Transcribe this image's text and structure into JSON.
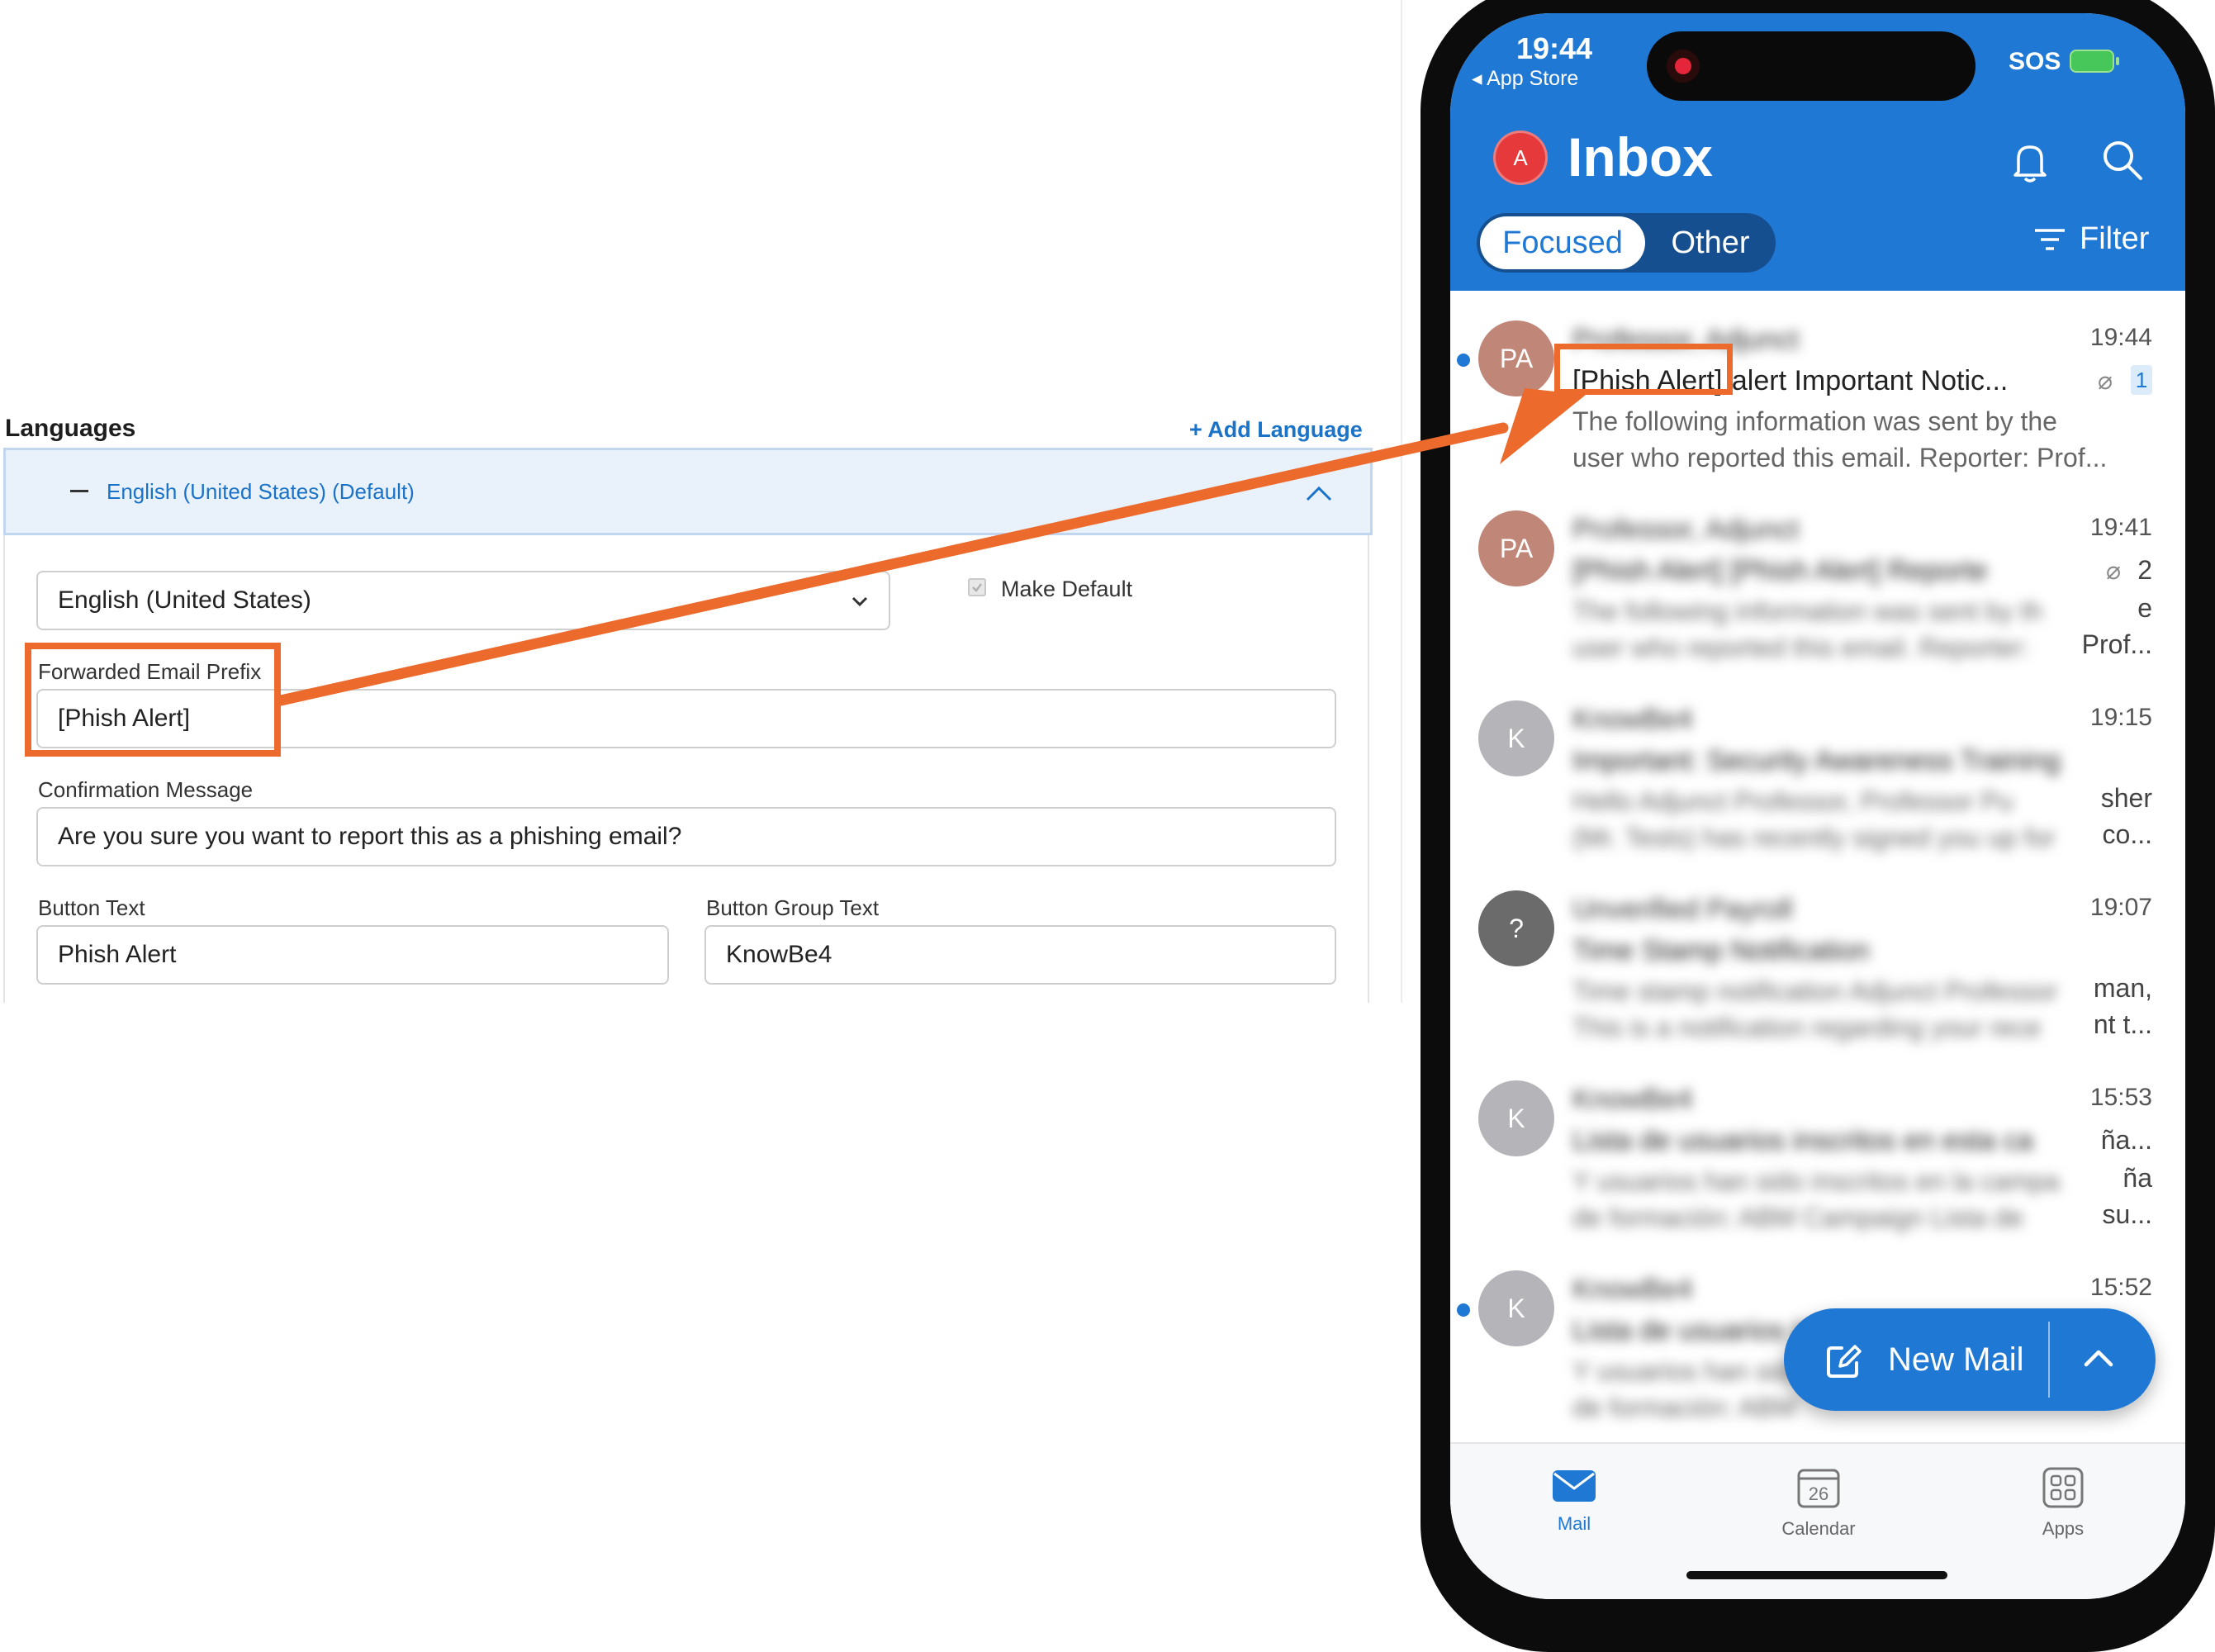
{
  "settings": {
    "section_title": "Languages",
    "add_language": "Add Language",
    "add_icon": "plus-icon",
    "language_row_label": "English (United States) (Default)",
    "language_select_value": "English (United States)",
    "make_default_label": "Make Default",
    "forwarded_prefix_label": "Forwarded Email Prefix",
    "forwarded_prefix_value": "[Phish Alert]",
    "confirmation_label": "Confirmation Message",
    "confirmation_value": "Are you sure you want to report this as a phishing email?",
    "button_text_label": "Button Text",
    "button_text_value": "Phish Alert",
    "button_group_label": "Button Group Text",
    "button_group_value": "KnowBe4"
  },
  "phone": {
    "status": {
      "time": "19:44",
      "back_app": "App Store",
      "sos": "SOS"
    },
    "header": {
      "avatar_letter": "A",
      "title": "Inbox",
      "tab_focused": "Focused",
      "tab_other": "Other",
      "filter": "Filter"
    },
    "emails": [
      {
        "initials": "PA",
        "avatar_color": "#c08678",
        "sender": "Professor, Adjunct",
        "time": "19:44",
        "subject_prefix": "[Phish Alert]",
        "subject_rest": "alert Important Notic...",
        "preview_1": "The following information was sent by the",
        "preview_2": "user who reported this email. Reporter: Prof...",
        "count": "1"
      },
      {
        "initials": "PA",
        "avatar_color": "#c08678",
        "sender": "Professor, Adjunct",
        "time": "19:41",
        "subject_blur": "[Phish Alert] [Phish Alert] Reporte",
        "preview_blur_1": "The following information was sent by th",
        "preview_tail_1": "e",
        "preview_blur_2": "user who reported this email. Reporter:",
        "preview_tail_2": "Prof...",
        "count": "2"
      },
      {
        "initials": "K",
        "avatar_color": "#b5b5b9",
        "sender": "KnowBe4",
        "time": "19:15",
        "subject_blur": "Important: Security Awareness Training",
        "preview_blur_1": "Hello Adjunct Professor, Professor Pu",
        "preview_tail_1": "sher",
        "preview_blur_2": "(Mr. Tests) has recently signed you up for",
        "preview_tail_2": "co..."
      },
      {
        "initials": "?",
        "avatar_color": "#6b6b6b",
        "sender": "Unverified Payroll",
        "time": "19:07",
        "subject_blur": "Time Stamp Notification",
        "preview_blur_1": "Time stamp notification Adjunct Professor",
        "preview_tail_1": "man,",
        "preview_blur_2": "This is a notification regarding your rece",
        "preview_tail_2": "nt t..."
      },
      {
        "initials": "K",
        "avatar_color": "#b5b5b9",
        "sender": "KnowBe4",
        "time": "15:53",
        "subject_blur": "Lista de usuarios inscritos en esta camp",
        "subject_tail": "ña...",
        "preview_blur_1": "Y usuarios han sido inscritos en la campa",
        "preview_tail_1": "ña",
        "preview_blur_2": "de formación: ABM Campaign Lista de",
        "preview_tail_2": "su..."
      },
      {
        "initials": "K",
        "avatar_color": "#b5b5b9",
        "sender": "KnowBe4",
        "time": "15:52",
        "subject_blur": "Lista de usuarios ins",
        "preview_blur_1": "Y usuarios han sido",
        "preview_blur_2": "de formación: ABM"
      }
    ],
    "new_mail": "New Mail",
    "tabs": {
      "mail": "Mail",
      "calendar": "Calendar",
      "calendar_day": "26",
      "apps": "Apps"
    }
  },
  "colors": {
    "accent_orange": "#ec6a2c",
    "outlook_blue": "#1f78d4",
    "link_blue": "#1a73c7"
  }
}
